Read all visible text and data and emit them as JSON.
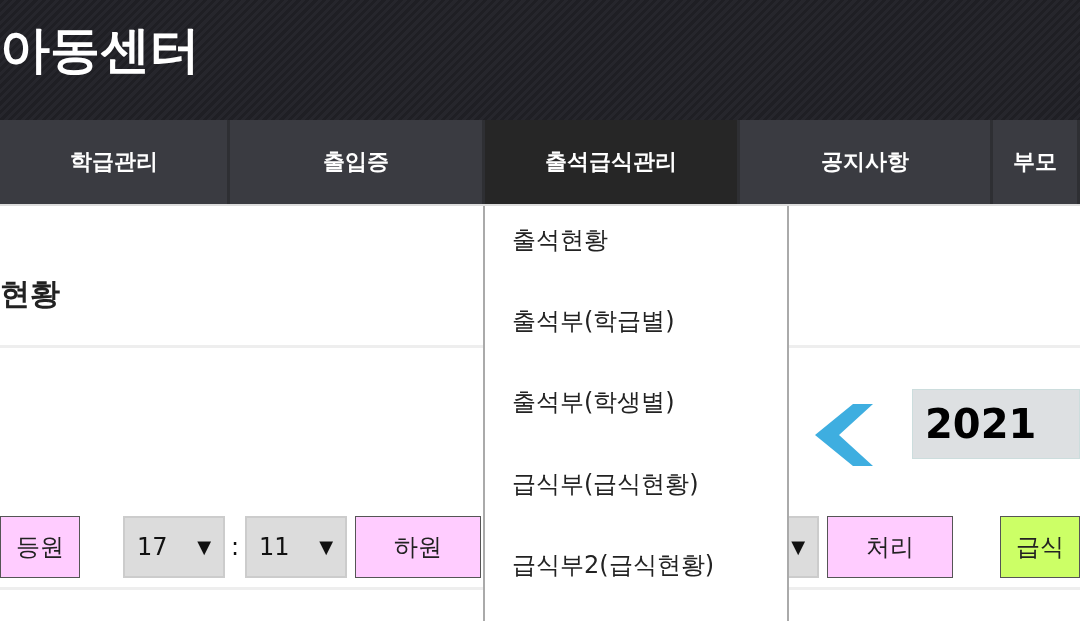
{
  "header": {
    "title": "아동센터"
  },
  "nav": [
    {
      "label": "학급관리",
      "selected": false
    },
    {
      "label": "출입증",
      "selected": false
    },
    {
      "label": "출석급식관리",
      "selected": true
    },
    {
      "label": "공지사항",
      "selected": false
    },
    {
      "label": "부모",
      "selected": false
    }
  ],
  "dropdown": {
    "items": [
      {
        "label": "출석현황"
      },
      {
        "label": "출석부(학급별)"
      },
      {
        "label": "출석부(학생별)"
      },
      {
        "label": "급식부(급식현황)"
      },
      {
        "label": "급식부2(급식현황)"
      }
    ]
  },
  "page_heading": "현황",
  "year": {
    "value": "2021"
  },
  "controls": [
    {
      "kind": "button",
      "label": "등원",
      "color": "#ffccff"
    },
    {
      "kind": "select",
      "value": "17",
      "arrow": "▼"
    },
    {
      "kind": "separator",
      "label": ":"
    },
    {
      "kind": "select",
      "value": "11",
      "arrow": "▼"
    },
    {
      "kind": "button",
      "label": "하원",
      "color": "#ffccff"
    },
    {
      "kind": "select",
      "arrow": "▼"
    },
    {
      "kind": "button",
      "label": "처리",
      "color": "#ffccff"
    },
    {
      "kind": "button",
      "label": "급식",
      "color": "#ccff66"
    }
  ]
}
